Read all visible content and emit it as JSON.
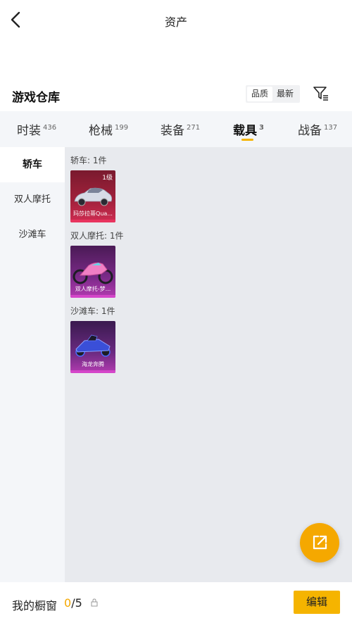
{
  "header": {
    "title": "资产"
  },
  "warehouse": {
    "title": "游戏仓库",
    "sort_options": [
      "品质",
      "最新"
    ]
  },
  "tabs": [
    {
      "label": "时装",
      "count": "436"
    },
    {
      "label": "枪械",
      "count": "199"
    },
    {
      "label": "装备",
      "count": "271"
    },
    {
      "label": "载具",
      "count": "3",
      "active": true
    },
    {
      "label": "战备",
      "count": "137"
    }
  ],
  "sidebar": {
    "items": [
      "轿车",
      "双人摩托",
      "沙滩车"
    ],
    "active": "轿车"
  },
  "groups": [
    {
      "label": "轿车: 1件",
      "item": {
        "name": "玛莎拉蒂Qua...",
        "level": "1级",
        "theme": "red"
      }
    },
    {
      "label": "双人摩托: 1件",
      "item": {
        "name": "双人摩托-梦...",
        "level": "",
        "theme": "pink"
      }
    },
    {
      "label": "沙滩车: 1件",
      "item": {
        "name": "海龙奔腾",
        "level": "",
        "theme": "pink"
      }
    }
  ],
  "showcase": {
    "label": "我的橱窗",
    "current": "0",
    "total": "/5",
    "edit_label": "编辑"
  },
  "colors": {
    "accent": "#f5b400",
    "card_red": "#c8264a",
    "card_pink": "#c93fc0"
  },
  "icons": [
    "back-arrow-icon",
    "filter-icon",
    "share-icon",
    "lock-icon"
  ]
}
